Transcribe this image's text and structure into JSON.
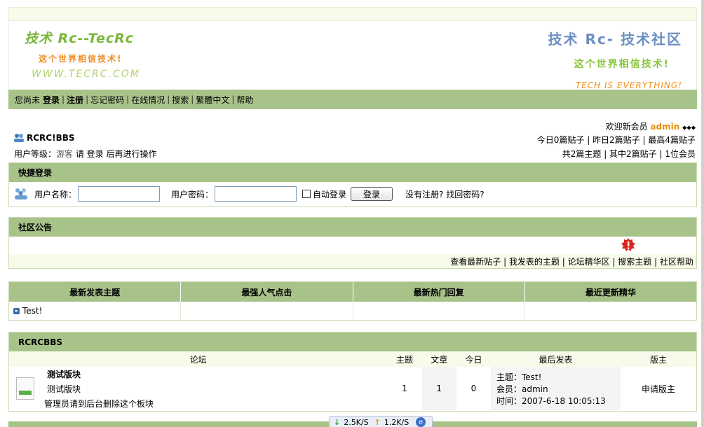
{
  "logo_left": {
    "title": "技术 Rc--TecRc",
    "slogan": "这个世界相信技术!",
    "url": "WWW.TECRC.COM"
  },
  "logo_right": {
    "title": "技术 Rc- 技术社区",
    "slogan": "这个世界相信技术!",
    "tagline": "TECH IS EVERYTHING!"
  },
  "nav": {
    "not_logged": "您尚未",
    "login": "登录",
    "register": "注册",
    "forgot": "忘记密码",
    "online": "在线情况",
    "search": "搜索",
    "traditional": "繁體中文",
    "help": "帮助"
  },
  "welcome": {
    "prefix": "欢迎新会员",
    "member": "admin",
    "arrows": "⬥⬥⬥"
  },
  "stats": {
    "today": "今日0篇贴子",
    "yesterday": "昨日2篇贴子",
    "max": "最高4篇贴子",
    "topics": "共2篇主题",
    "posts": "其中2篇贴子",
    "members": "1位会员"
  },
  "bbs_name": "RCRC!BBS",
  "user_level": {
    "label": "用户等级：",
    "value": "游客",
    "hint": "请 登录 后再进行操作"
  },
  "quick_login": {
    "title": "快捷登录",
    "username_label": "用户名称：",
    "password_label": "用户密码：",
    "auto_login": "自动登录",
    "submit": "登录",
    "links": "没有注册? 找回密码?"
  },
  "notice": {
    "title": "社区公告",
    "links": [
      "查看最新贴子",
      "我发表的主题",
      "论坛精华区",
      "搜索主题",
      "社区帮助"
    ]
  },
  "tri": {
    "headers": [
      "最新发表主题",
      "最强人气点击",
      "最新热门回复",
      "最近更新精华"
    ],
    "latest_topic": "Test!"
  },
  "forum": {
    "category": "RCRCBBS",
    "columns": [
      "论坛",
      "主题",
      "文章",
      "今日",
      "最后发表",
      "版主"
    ],
    "row": {
      "name": "测试版块",
      "desc": "测试版块",
      "admin_note": "管理员请到后台删除这个板块",
      "topics": "1",
      "posts": "1",
      "today": "0",
      "last_topic": "主题：Test!",
      "last_member": "会员：admin",
      "last_time": "时间：2007-6-18 10:05:13",
      "moderator": "申请版主"
    }
  },
  "speed": {
    "down": "2.5K/S",
    "up": "1.2K/S"
  }
}
